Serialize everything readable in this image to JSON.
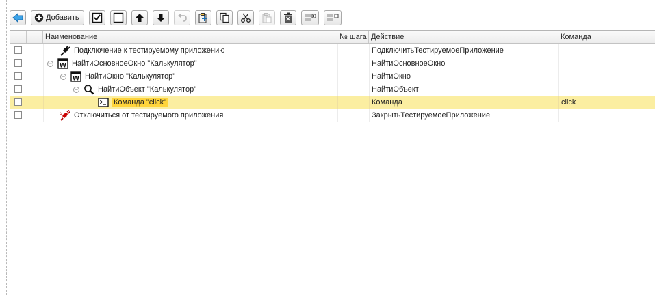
{
  "toolbar": {
    "add_label": "Добавить"
  },
  "grid": {
    "columns": {
      "name": "Наименование",
      "step": "№ шага",
      "action": "Действие",
      "command": "Команда"
    },
    "rows": [
      {
        "name": "Подключение к тестируемому приложению",
        "action": "ПодключитьТестируемоеПриложение",
        "command": "",
        "icon": "plug-icon"
      },
      {
        "name": "НайтиОсновноеОкно \"Калькулятор\"",
        "action": "НайтиОсновноеОкно",
        "command": "",
        "icon": "window-w-icon"
      },
      {
        "name": "НайтиОкно \"Калькулятор\"",
        "action": "НайтиОкно",
        "command": "",
        "icon": "window-w-icon"
      },
      {
        "name": "НайтиОбъект \"Калькулятор\"",
        "action": "НайтиОбъект",
        "command": "",
        "icon": "magnifier-icon"
      },
      {
        "name": "Команда \"click\"",
        "action": "Команда",
        "command": "click",
        "icon": "command-icon"
      },
      {
        "name": "Отключиться от тестируемого приложения",
        "action": "ЗакрытьТестируемоеПриложение",
        "command": "",
        "icon": "unplug-icon"
      }
    ]
  },
  "colors": {
    "selected_row": "#fbeea1",
    "highlight": "#ffd43b"
  }
}
